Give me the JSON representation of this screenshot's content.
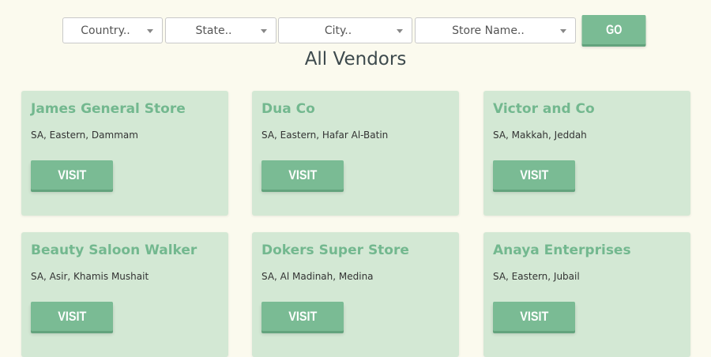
{
  "filters": {
    "country_placeholder": "Country..",
    "state_placeholder": "State..",
    "city_placeholder": "City..",
    "store_name_placeholder": "Store Name..",
    "go_label": "GO"
  },
  "page_title": "All Vendors",
  "vendors": [
    {
      "name": "James General Store",
      "address": "SA, Eastern, Dammam",
      "visit_label": "VISIT"
    },
    {
      "name": "Dua Co",
      "address": "SA, Eastern, Hafar Al-Batin",
      "visit_label": "VISIT"
    },
    {
      "name": "Victor and Co",
      "address": "SA, Makkah, Jeddah",
      "visit_label": "VISIT"
    },
    {
      "name": "Beauty Saloon Walker",
      "address": "SA, Asir, Khamis Mushait",
      "visit_label": "VISIT"
    },
    {
      "name": "Dokers Super Store",
      "address": "SA, Al Madinah, Medina",
      "visit_label": "VISIT"
    },
    {
      "name": "Anaya Enterprises",
      "address": "SA, Eastern, Jubail",
      "visit_label": "VISIT"
    }
  ],
  "colors": {
    "background": "#fbfaee",
    "card_background": "#d3e8d4",
    "accent_green": "#7abb94",
    "title_green": "#73b88f"
  }
}
